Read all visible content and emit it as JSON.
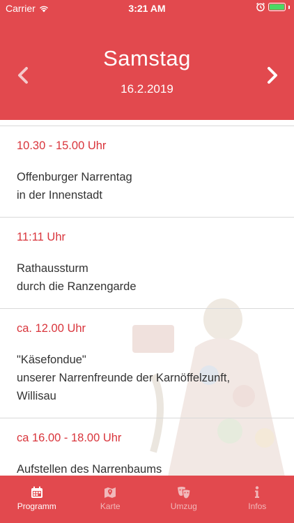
{
  "status_bar": {
    "carrier": "Carrier",
    "time": "3:21 AM",
    "battery_level": 1.0
  },
  "header": {
    "day": "Samstag",
    "date": "16.2.2019",
    "prev_icon": "chevron-left-icon",
    "next_icon": "chevron-right-icon",
    "color": "#e2494e"
  },
  "events": [
    {
      "time": "10.30 - 15.00 Uhr",
      "description": "Offenburger Narrentag\nin der Innenstadt"
    },
    {
      "time": "11:11 Uhr",
      "description": "Rathaussturm\ndurch die Ranzengarde"
    },
    {
      "time": "ca. 12.00 Uhr",
      "description": "\"Käsefondue\"\nunserer Narrenfreunde der Karnöffelzunft,\nWillisau"
    },
    {
      "time": "ca 16.00 - 18.00 Uhr",
      "description": "Aufstellen des Narrenbaums"
    }
  ],
  "tabs": [
    {
      "label": "Programm",
      "icon": "calendar-icon",
      "active": true
    },
    {
      "label": "Karte",
      "icon": "map-icon",
      "active": false
    },
    {
      "label": "Umzug",
      "icon": "masks-icon",
      "active": false
    },
    {
      "label": "Infos",
      "icon": "info-icon",
      "active": false
    }
  ],
  "colors": {
    "accent": "#e2494e",
    "time_text": "#d9353c",
    "inactive_tab": "#f1b8ba"
  }
}
